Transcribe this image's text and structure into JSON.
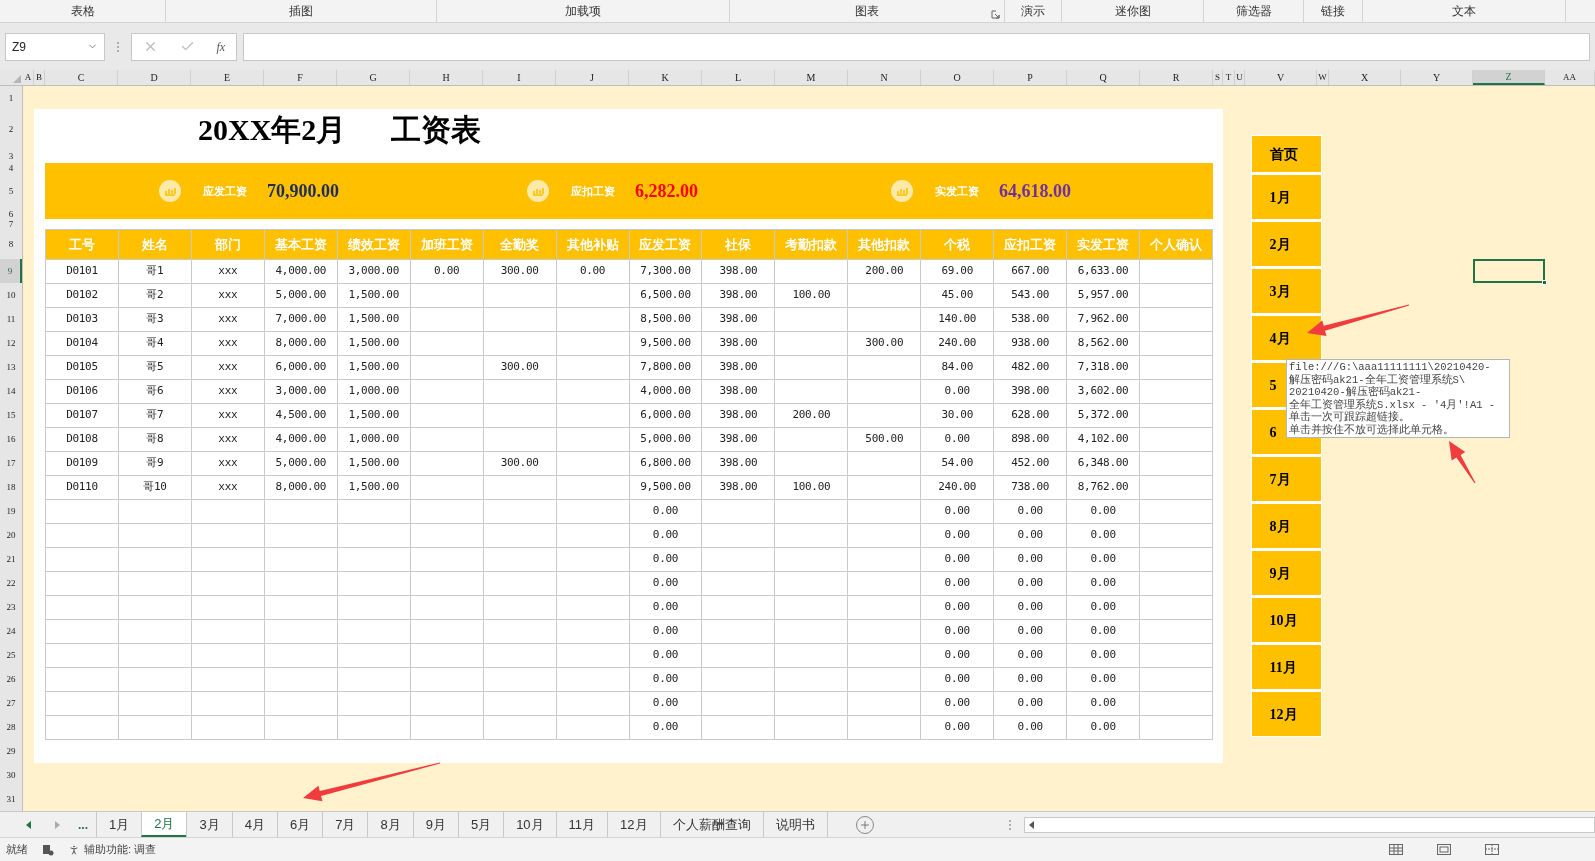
{
  "ribbon_groups": [
    {
      "label": "表格",
      "has_launcher": false
    },
    {
      "label": "插图",
      "has_launcher": false
    },
    {
      "label": "加载项",
      "has_launcher": false
    },
    {
      "label": "图表",
      "has_launcher": true
    },
    {
      "label": "演示",
      "has_launcher": false
    },
    {
      "label": "迷你图",
      "has_launcher": false
    },
    {
      "label": "筛选器",
      "has_launcher": false
    },
    {
      "label": "链接",
      "has_launcher": false
    },
    {
      "label": "文本",
      "has_launcher": false
    }
  ],
  "formula_bar": {
    "name_box": "Z9",
    "function_button": "fx"
  },
  "column_headers": [
    {
      "label": "A",
      "selected": false
    },
    {
      "label": "B",
      "selected": false
    },
    {
      "label": "C",
      "selected": false
    },
    {
      "label": "D",
      "selected": false
    },
    {
      "label": "E",
      "selected": false
    },
    {
      "label": "F",
      "selected": false
    },
    {
      "label": "G",
      "selected": false
    },
    {
      "label": "H",
      "selected": false
    },
    {
      "label": "I",
      "selected": false
    },
    {
      "label": "J",
      "selected": false
    },
    {
      "label": "K",
      "selected": false
    },
    {
      "label": "L",
      "selected": false
    },
    {
      "label": "M",
      "selected": false
    },
    {
      "label": "N",
      "selected": false
    },
    {
      "label": "O",
      "selected": false
    },
    {
      "label": "P",
      "selected": false
    },
    {
      "label": "Q",
      "selected": false
    },
    {
      "label": "R",
      "selected": false
    },
    {
      "label": "S",
      "selected": false
    },
    {
      "label": "T",
      "selected": false
    },
    {
      "label": "U",
      "selected": false
    },
    {
      "label": "V",
      "selected": false
    },
    {
      "label": "W",
      "selected": false
    },
    {
      "label": "X",
      "selected": false
    },
    {
      "label": "Y",
      "selected": false
    },
    {
      "label": "Z",
      "selected": true
    },
    {
      "label": "AA",
      "selected": false
    }
  ],
  "row_headers": [
    {
      "label": "1",
      "selected": false
    },
    {
      "label": "2",
      "selected": false
    },
    {
      "label": "3",
      "selected": false
    },
    {
      "label": "4",
      "selected": false
    },
    {
      "label": "5",
      "selected": false
    },
    {
      "label": "6",
      "selected": false
    },
    {
      "label": "7",
      "selected": false
    },
    {
      "label": "8",
      "selected": false
    },
    {
      "label": "9",
      "selected": true
    },
    {
      "label": "10",
      "selected": false
    },
    {
      "label": "11",
      "selected": false
    },
    {
      "label": "12",
      "selected": false
    },
    {
      "label": "13",
      "selected": false
    },
    {
      "label": "14",
      "selected": false
    },
    {
      "label": "15",
      "selected": false
    },
    {
      "label": "16",
      "selected": false
    },
    {
      "label": "17",
      "selected": false
    },
    {
      "label": "18",
      "selected": false
    },
    {
      "label": "19",
      "selected": false
    },
    {
      "label": "20",
      "selected": false
    },
    {
      "label": "21",
      "selected": false
    },
    {
      "label": "22",
      "selected": false
    },
    {
      "label": "23",
      "selected": false
    },
    {
      "label": "24",
      "selected": false
    },
    {
      "label": "25",
      "selected": false
    },
    {
      "label": "26",
      "selected": false
    },
    {
      "label": "27",
      "selected": false
    },
    {
      "label": "28",
      "selected": false
    },
    {
      "label": "29",
      "selected": false
    },
    {
      "label": "30",
      "selected": false
    },
    {
      "label": "31",
      "selected": false
    }
  ],
  "title": "20XX年2月      工资表",
  "summary": [
    {
      "label": "应发工资",
      "value": "70,900.00",
      "color": "#1f2d5a"
    },
    {
      "label": "应扣工资",
      "value": "6,282.00",
      "color": "#ff0000"
    },
    {
      "label": "实发工资",
      "value": "64,618.00",
      "color": "#7030a0"
    }
  ],
  "table": {
    "columns": [
      "工号",
      "姓名",
      "部门",
      "基本工资",
      "绩效工资",
      "加班工资",
      "全勤奖",
      "其他补贴",
      "应发工资",
      "社保",
      "考勤扣款",
      "其他扣款",
      "个税",
      "应扣工资",
      "实发工资",
      "个人确认"
    ],
    "rows": [
      [
        "D0101",
        "哥1",
        "xxx",
        "4,000.00",
        "3,000.00",
        "0.00",
        "300.00",
        "0.00",
        "7,300.00",
        "398.00",
        null,
        "200.00",
        "69.00",
        "667.00",
        "6,633.00",
        null
      ],
      [
        "D0102",
        "哥2",
        "xxx",
        "5,000.00",
        "1,500.00",
        null,
        null,
        null,
        "6,500.00",
        "398.00",
        "100.00",
        null,
        "45.00",
        "543.00",
        "5,957.00",
        null
      ],
      [
        "D0103",
        "哥3",
        "xxx",
        "7,000.00",
        "1,500.00",
        null,
        null,
        null,
        "8,500.00",
        "398.00",
        null,
        null,
        "140.00",
        "538.00",
        "7,962.00",
        null
      ],
      [
        "D0104",
        "哥4",
        "xxx",
        "8,000.00",
        "1,500.00",
        null,
        null,
        null,
        "9,500.00",
        "398.00",
        null,
        "300.00",
        "240.00",
        "938.00",
        "8,562.00",
        null
      ],
      [
        "D0105",
        "哥5",
        "xxx",
        "6,000.00",
        "1,500.00",
        null,
        "300.00",
        null,
        "7,800.00",
        "398.00",
        null,
        null,
        "84.00",
        "482.00",
        "7,318.00",
        null
      ],
      [
        "D0106",
        "哥6",
        "xxx",
        "3,000.00",
        "1,000.00",
        null,
        null,
        null,
        "4,000.00",
        "398.00",
        null,
        null,
        "0.00",
        "398.00",
        "3,602.00",
        null
      ],
      [
        "D0107",
        "哥7",
        "xxx",
        "4,500.00",
        "1,500.00",
        null,
        null,
        null,
        "6,000.00",
        "398.00",
        "200.00",
        null,
        "30.00",
        "628.00",
        "5,372.00",
        null
      ],
      [
        "D0108",
        "哥8",
        "xxx",
        "4,000.00",
        "1,000.00",
        null,
        null,
        null,
        "5,000.00",
        "398.00",
        null,
        "500.00",
        "0.00",
        "898.00",
        "4,102.00",
        null
      ],
      [
        "D0109",
        "哥9",
        "xxx",
        "5,000.00",
        "1,500.00",
        null,
        "300.00",
        null,
        "6,800.00",
        "398.00",
        null,
        null,
        "54.00",
        "452.00",
        "6,348.00",
        null
      ],
      [
        "D0110",
        "哥10",
        "xxx",
        "8,000.00",
        "1,500.00",
        null,
        null,
        null,
        "9,500.00",
        "398.00",
        "100.00",
        null,
        "240.00",
        "738.00",
        "8,762.00",
        null
      ],
      [
        null,
        null,
        null,
        null,
        null,
        null,
        null,
        null,
        "0.00",
        null,
        null,
        null,
        "0.00",
        "0.00",
        "0.00",
        null
      ],
      [
        null,
        null,
        null,
        null,
        null,
        null,
        null,
        null,
        "0.00",
        null,
        null,
        null,
        "0.00",
        "0.00",
        "0.00",
        null
      ],
      [
        null,
        null,
        null,
        null,
        null,
        null,
        null,
        null,
        "0.00",
        null,
        null,
        null,
        "0.00",
        "0.00",
        "0.00",
        null
      ],
      [
        null,
        null,
        null,
        null,
        null,
        null,
        null,
        null,
        "0.00",
        null,
        null,
        null,
        "0.00",
        "0.00",
        "0.00",
        null
      ],
      [
        null,
        null,
        null,
        null,
        null,
        null,
        null,
        null,
        "0.00",
        null,
        null,
        null,
        "0.00",
        "0.00",
        "0.00",
        null
      ],
      [
        null,
        null,
        null,
        null,
        null,
        null,
        null,
        null,
        "0.00",
        null,
        null,
        null,
        "0.00",
        "0.00",
        "0.00",
        null
      ],
      [
        null,
        null,
        null,
        null,
        null,
        null,
        null,
        null,
        "0.00",
        null,
        null,
        null,
        "0.00",
        "0.00",
        "0.00",
        null
      ],
      [
        null,
        null,
        null,
        null,
        null,
        null,
        null,
        null,
        "0.00",
        null,
        null,
        null,
        "0.00",
        "0.00",
        "0.00",
        null
      ],
      [
        null,
        null,
        null,
        null,
        null,
        null,
        null,
        null,
        "0.00",
        null,
        null,
        null,
        "0.00",
        "0.00",
        "0.00",
        null
      ],
      [
        null,
        null,
        null,
        null,
        null,
        null,
        null,
        null,
        "0.00",
        null,
        null,
        null,
        "0.00",
        "0.00",
        "0.00",
        null
      ]
    ]
  },
  "nav_buttons": [
    {
      "label": "首页"
    },
    {
      "label": "1月"
    },
    {
      "label": "2月"
    },
    {
      "label": "3月"
    },
    {
      "label": "4月"
    },
    {
      "label": "5"
    },
    {
      "label": "6"
    },
    {
      "label": "7月"
    },
    {
      "label": "8月"
    },
    {
      "label": "9月"
    },
    {
      "label": "10月"
    },
    {
      "label": "11月"
    },
    {
      "label": "12月"
    }
  ],
  "tooltip": {
    "lines": [
      "file:///G:\\aaa11111111\\20210420-",
      "解压密码ak21-全年工资管理系统S\\",
      "20210420-解压密码ak21-",
      "全年工资管理系统S.xlsx - '4月'!A1 -",
      "单击一次可跟踪超链接。",
      "单击并按住不放可选择此单元格。"
    ]
  },
  "sheet_tabs": {
    "overflow": "...",
    "tabs": [
      {
        "label": "1月",
        "selected": false
      },
      {
        "label": "2月",
        "selected": true
      },
      {
        "label": "3月",
        "selected": false
      },
      {
        "label": "4月",
        "selected": false
      },
      {
        "label": "6月",
        "selected": false
      },
      {
        "label": "7月",
        "selected": false
      },
      {
        "label": "8月",
        "selected": false
      },
      {
        "label": "9月",
        "selected": false
      },
      {
        "label": "5月",
        "selected": false
      },
      {
        "label": "10月",
        "selected": false
      },
      {
        "label": "11月",
        "selected": false
      },
      {
        "label": "12月",
        "selected": false
      },
      {
        "label": "个人薪酬查询",
        "selected": false
      },
      {
        "label": "说明书",
        "selected": false
      }
    ]
  },
  "status_bar": {
    "mode": "就绪",
    "accessibility": "辅助功能: 调查"
  }
}
